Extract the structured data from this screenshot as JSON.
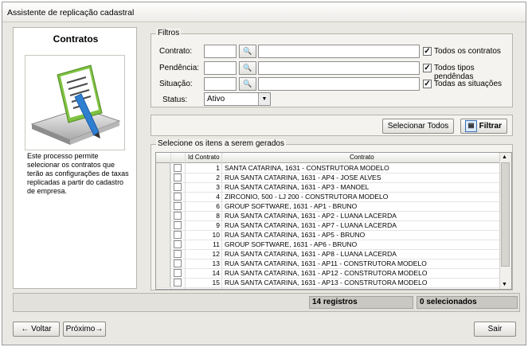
{
  "window": {
    "title": "Assistente de replicação cadastral"
  },
  "left_panel": {
    "title": "Contratos",
    "description": "Este processo permite selecionar os contratos que terão as configurações de taxas replicadas a partir do cadastro de empresa."
  },
  "filters": {
    "legend": "Filtros",
    "contrato": {
      "label": "Contrato:",
      "code": "",
      "desc": "",
      "checkbox_label": "Todos os contratos",
      "checked": true
    },
    "pendencia": {
      "label": "Pendência:",
      "code": "",
      "desc": "",
      "checkbox_label": "Todos tipos pendêndas",
      "checked": true
    },
    "situacao": {
      "label": "Situação:",
      "code": "",
      "desc": "",
      "checkbox_label": "Todas as situações",
      "checked": true
    },
    "status": {
      "label": "Status:",
      "value": "Ativo"
    },
    "search_glyph": "🔍",
    "check_glyph": "✓",
    "dropdown_glyph": "▼"
  },
  "actions": {
    "select_all": "Selecionar Todos",
    "filter": "Filtrar"
  },
  "items": {
    "legend": "Selecione os itens a serem gerados",
    "columns": {
      "id": "Id Contrato",
      "contract": "Contrato"
    },
    "rows": [
      {
        "id": "1",
        "contract": "SANTA CATARINA, 1631 - CONSTRUTORA MODELO"
      },
      {
        "id": "2",
        "contract": "RUA SANTA CATARINA, 1631 - AP4 - JOSE ALVES"
      },
      {
        "id": "3",
        "contract": "RUA SANTA CATARINA, 1631 - AP3 - MANOEL"
      },
      {
        "id": "4",
        "contract": "ZIRCONIO, 500 - LJ 200 - CONSTRUTORA MODELO"
      },
      {
        "id": "6",
        "contract": "GROUP SOFTWARE, 1631 - AP1 - BRUNO"
      },
      {
        "id": "8",
        "contract": "RUA SANTA CATARINA, 1631 - AP2 - LUANA LACERDA"
      },
      {
        "id": "9",
        "contract": "RUA SANTA CATARINA, 1631 - AP7 - LUANA LACERDA"
      },
      {
        "id": "10",
        "contract": "RUA SANTA CATARINA, 1631 - AP5 - BRUNO"
      },
      {
        "id": "11",
        "contract": "GROUP SOFTWARE, 1631 - AP6 - BRUNO"
      },
      {
        "id": "12",
        "contract": "RUA SANTA CATARINA, 1631 - AP8 - LUANA LACERDA"
      },
      {
        "id": "13",
        "contract": "RUA SANTA CATARINA, 1631 - AP11 - CONSTRUTORA MODELO"
      },
      {
        "id": "14",
        "contract": "RUA SANTA CATARINA, 1631 - AP12 - CONSTRUTORA MODELO"
      },
      {
        "id": "15",
        "contract": "RUA SANTA CATARINA, 1631 - AP13 - CONSTRUTORA MODELO"
      }
    ]
  },
  "status_bar": {
    "count": "14 registros",
    "selected": "0 selecionados"
  },
  "footer": {
    "back": "Voltar",
    "next": "Próximo",
    "exit": "Sair",
    "back_arrow": "←",
    "next_arrow": "→"
  }
}
